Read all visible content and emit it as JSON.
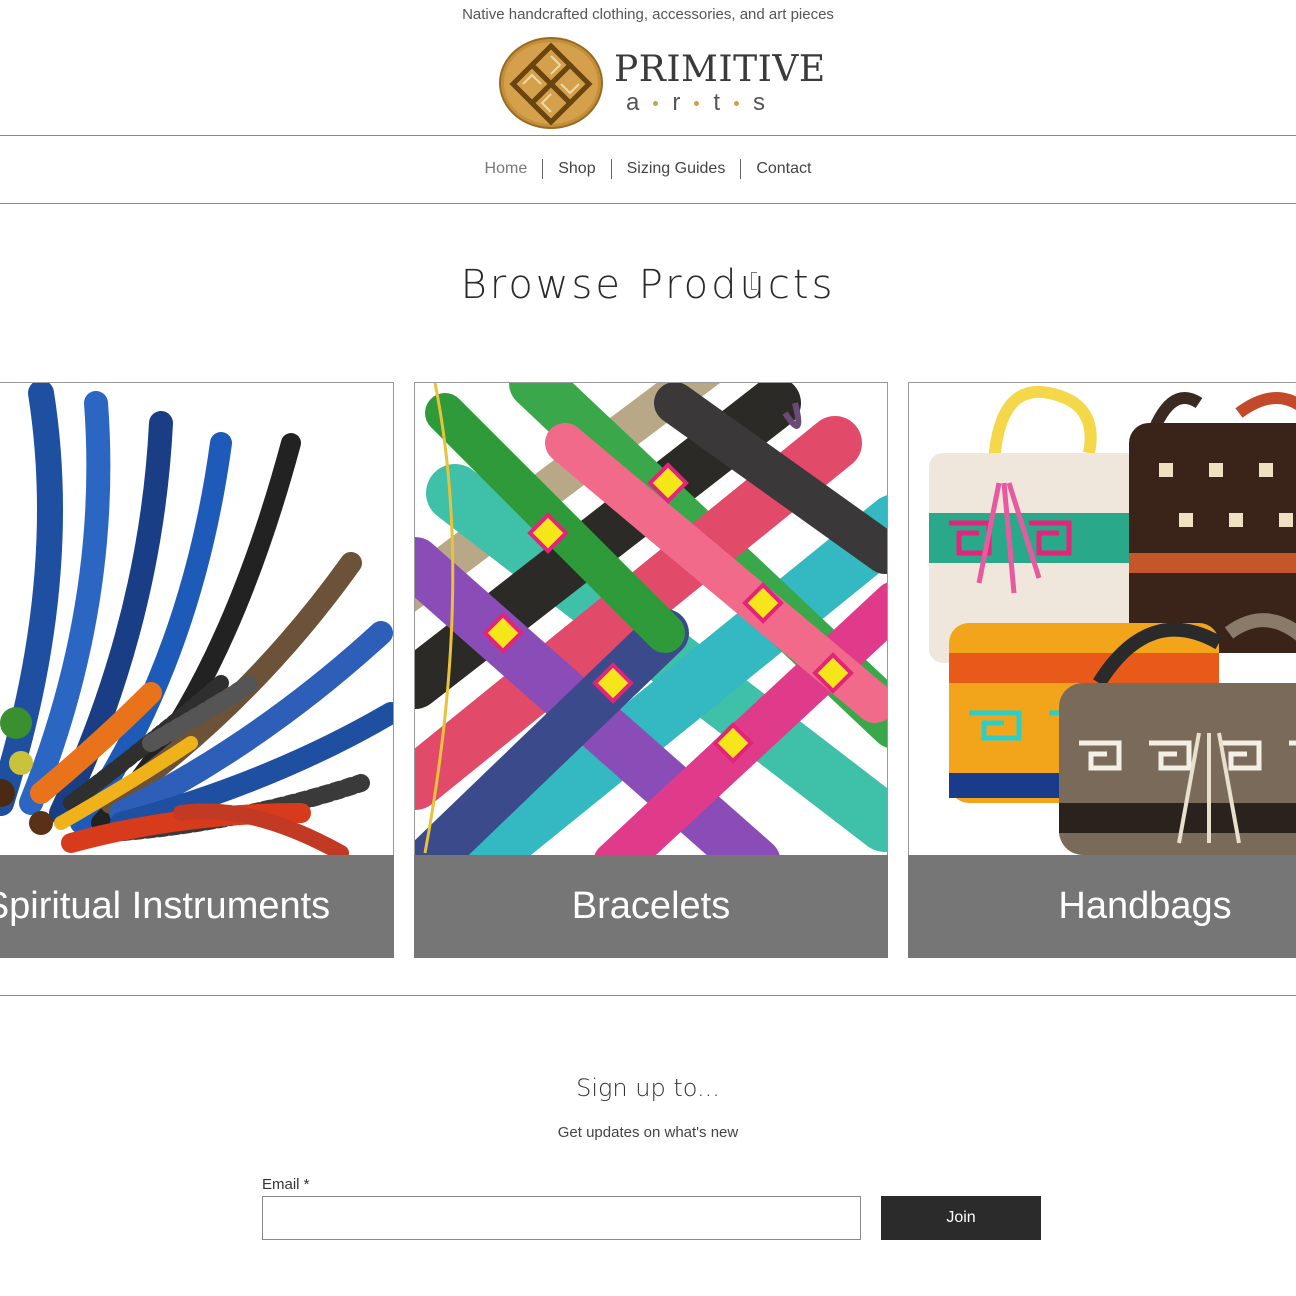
{
  "header": {
    "tagline": "Native handcrafted clothing, accessories, and art pieces",
    "logo": {
      "primary": "PRIMITIVE",
      "secondary": [
        "a",
        "r",
        "t",
        "s"
      ],
      "badge_color": "#b8842f",
      "dot_color": "#c8a24a"
    }
  },
  "nav": {
    "items": [
      {
        "label": "Home",
        "active": true
      },
      {
        "label": "Shop",
        "active": false
      },
      {
        "label": "Sizing Guides",
        "active": false
      },
      {
        "label": "Contact",
        "active": false
      }
    ]
  },
  "main": {
    "heading": "Browse Products",
    "products": [
      {
        "label": "Spiritual Instruments",
        "image": "feathers-photo"
      },
      {
        "label": "Bracelets",
        "image": "woven-bracelets-photo"
      },
      {
        "label": "Handbags",
        "image": "woven-handbags-photo"
      }
    ],
    "label_bg_color": "#767676"
  },
  "signup": {
    "title": "Sign up to...",
    "subtitle": "Get updates on what's new",
    "email_label": "Email *",
    "email_value": "",
    "join_label": "Join",
    "join_bg_color": "#2b2b2b"
  }
}
